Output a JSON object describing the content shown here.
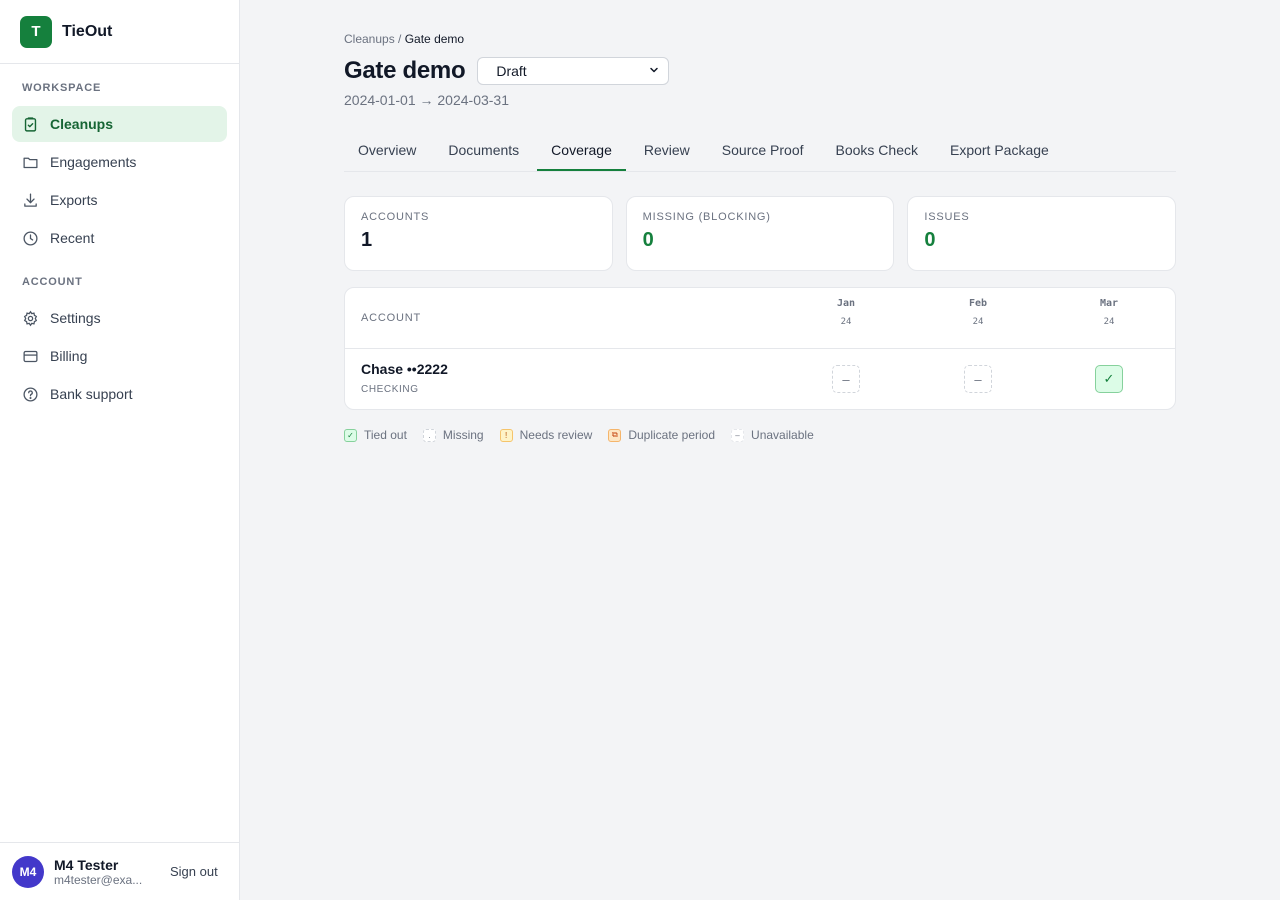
{
  "brand": {
    "logo_letter": "T",
    "name": "TieOut"
  },
  "sidebar": {
    "workspace_label": "WORKSPACE",
    "workspace_items": [
      {
        "label": "Cleanups",
        "icon": "clipboard-check-icon",
        "active": true
      },
      {
        "label": "Engagements",
        "icon": "folder-icon"
      },
      {
        "label": "Exports",
        "icon": "download-icon"
      },
      {
        "label": "Recent",
        "icon": "clock-icon"
      }
    ],
    "account_label": "ACCOUNT",
    "account_items": [
      {
        "label": "Settings",
        "icon": "gear-icon"
      },
      {
        "label": "Billing",
        "icon": "credit-card-icon"
      },
      {
        "label": "Bank support",
        "icon": "help-circle-icon"
      }
    ]
  },
  "user": {
    "initials": "M4",
    "name": "M4 Tester",
    "email": "m4tester@exa...",
    "signout_label": "Sign out"
  },
  "breadcrumb": {
    "parent": "Cleanups",
    "separator": " / ",
    "current": "Gate demo"
  },
  "page": {
    "title": "Gate demo",
    "status": "Draft",
    "date_range": "2024-01-01 → 2024-03-31"
  },
  "tabs": [
    {
      "label": "Overview"
    },
    {
      "label": "Documents"
    },
    {
      "label": "Coverage",
      "active": true
    },
    {
      "label": "Review"
    },
    {
      "label": "Source Proof"
    },
    {
      "label": "Books Check"
    },
    {
      "label": "Export Package"
    }
  ],
  "stats": [
    {
      "label": "ACCOUNTS",
      "value": "1",
      "color": "#111827"
    },
    {
      "label": "MISSING (BLOCKING)",
      "value": "0",
      "color": "#15803d"
    },
    {
      "label": "ISSUES",
      "value": "0",
      "color": "#15803d"
    }
  ],
  "table": {
    "account_header": "ACCOUNT",
    "months": [
      {
        "month": "Jan",
        "year": "24"
      },
      {
        "month": "Feb",
        "year": "24"
      },
      {
        "month": "Mar",
        "year": "24"
      }
    ],
    "rows": [
      {
        "name": "Chase ••2222",
        "type": "CHECKING",
        "cells": [
          {
            "status": "unavailable",
            "glyph": "–"
          },
          {
            "status": "unavailable",
            "glyph": "–"
          },
          {
            "status": "tied-out",
            "glyph": "✓"
          }
        ]
      }
    ]
  },
  "legend": [
    {
      "label": "Tied out",
      "glyph": "✓",
      "kind": "tied"
    },
    {
      "label": "Missing",
      "glyph": ".",
      "kind": "missing"
    },
    {
      "label": "Needs review",
      "glyph": "!",
      "kind": "review"
    },
    {
      "label": "Duplicate period",
      "glyph": "⧉",
      "kind": "dup"
    },
    {
      "label": "Unavailable",
      "glyph": "–",
      "kind": "unavail"
    }
  ],
  "colors": {
    "accent": "#15803d",
    "accent_bg": "#e3f4e8",
    "avatar": "#4338ca"
  }
}
